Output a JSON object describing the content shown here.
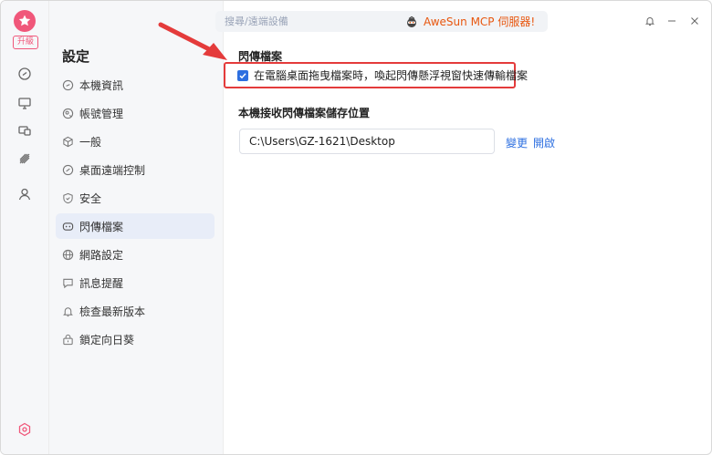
{
  "rail": {
    "upgrade_label": "升級",
    "icons": [
      "star-logo-icon",
      "link-icon",
      "monitor-icon",
      "devices-icon",
      "signal-icon",
      "user-icon",
      "settings-hex-icon"
    ],
    "accent": "#f0577a"
  },
  "topbar": {
    "search_placeholder": "搜尋/遠端設備",
    "promo_text": "AweSun MCP 伺服器!"
  },
  "nav": {
    "title": "設定",
    "items": [
      {
        "label": "本機資訊",
        "icon": "info-icon"
      },
      {
        "label": "帳號管理",
        "icon": "account-icon"
      },
      {
        "label": "一般",
        "icon": "cube-icon"
      },
      {
        "label": "桌面遠端控制",
        "icon": "remote-icon"
      },
      {
        "label": "安全",
        "icon": "shield-icon"
      },
      {
        "label": "閃傳檔案",
        "icon": "flash-transfer-icon",
        "active": true
      },
      {
        "label": "網路設定",
        "icon": "globe-icon"
      },
      {
        "label": "訊息提醒",
        "icon": "message-icon"
      },
      {
        "label": "檢查最新版本",
        "icon": "bell-icon"
      },
      {
        "label": "鎖定向日葵",
        "icon": "lock-icon"
      }
    ]
  },
  "content": {
    "section_title": "閃傳檔案",
    "checkbox_label": "在電腦桌面拖曳檔案時，喚起閃傳懸浮視窗快速傳輸檔案",
    "checkbox_checked": true,
    "save_location_title": "本機接收閃傳檔案儲存位置",
    "save_path": "C:\\Users\\GZ-1621\\Desktop",
    "change_label": "變更",
    "open_label": "開啟"
  },
  "colors": {
    "link": "#2d6fe0",
    "highlight": "#e43b3b",
    "promo": "#e8570f"
  }
}
